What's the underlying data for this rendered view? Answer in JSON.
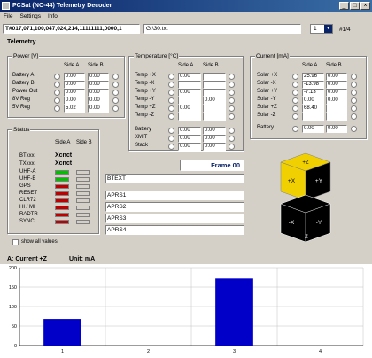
{
  "window": {
    "title": "PCSat (NO-44) Telemetry Decoder",
    "min": "_",
    "max": "□",
    "close": "×"
  },
  "menu": [
    "File",
    "Settings",
    "Info"
  ],
  "toolbar": {
    "packet": "T#017,071,100,047,024,214,11111111,0000,1",
    "filepath": "G:\\30.txt",
    "frame_select": "1",
    "frame_index": "#1/4"
  },
  "telemetry_label": "Telemetry",
  "power": {
    "title": "Power [V]",
    "side_a": "Side A",
    "side_b": "Side B",
    "rows": [
      {
        "label": "Battery A",
        "a": "0.00",
        "b": "0.00"
      },
      {
        "label": "Battery B",
        "a": "0.00",
        "b": "0.00"
      },
      {
        "label": "Power Out",
        "a": "0.00",
        "b": "0.00"
      },
      {
        "label": "8V Reg",
        "a": "0.00",
        "b": "0.00"
      },
      {
        "label": "5V Reg",
        "a": "5.02",
        "b": "0.00"
      }
    ]
  },
  "temperature": {
    "title": "Temperature [°C]",
    "side_a": "Side A",
    "side_b": "Side B",
    "rows": [
      {
        "label": "Temp +X",
        "a": "0.00",
        "b": ""
      },
      {
        "label": "Temp -X",
        "a": "",
        "b": ""
      },
      {
        "label": "Temp +Y",
        "a": "0.00",
        "b": ""
      },
      {
        "label": "Temp -Y",
        "a": "",
        "b": "0.00"
      },
      {
        "label": "Temp +Z",
        "a": "0.00",
        "b": ""
      },
      {
        "label": "Temp -Z",
        "a": "",
        "b": ""
      }
    ],
    "extra": [
      {
        "label": "Battery",
        "a": "0.00",
        "b": "0.00"
      },
      {
        "label": "XMIT",
        "a": "0.00",
        "b": "0.00"
      },
      {
        "label": "Stack",
        "a": "0.00",
        "b": "0.00"
      }
    ]
  },
  "current": {
    "title": "Current [mA]",
    "side_a": "Side A",
    "side_b": "Side B",
    "rows": [
      {
        "label": "Solar +X",
        "a": "25.96",
        "b": "0.00"
      },
      {
        "label": "Solar -X",
        "a": "-13.98",
        "b": "0.00"
      },
      {
        "label": "Solar +Y",
        "a": "-7.13",
        "b": "0.00"
      },
      {
        "label": "Solar -Y",
        "a": "0.00",
        "b": "0.00"
      },
      {
        "label": "Solar +Z",
        "a": "68.40",
        "b": ""
      },
      {
        "label": "Solar -Z",
        "a": "",
        "b": ""
      }
    ],
    "battery": {
      "label": "Battery",
      "a": "0.00",
      "b": "0.00"
    }
  },
  "status": {
    "title": "Status",
    "side_a": "Side A",
    "side_b": "Side B",
    "btxxx": {
      "label": "BTxxx",
      "value": "Xcnct"
    },
    "txxx": {
      "label": "TXxxx",
      "value": "Xcnct"
    },
    "rows": [
      {
        "label": "UHF-A",
        "a": "green",
        "b": "gray"
      },
      {
        "label": "UHF-B",
        "a": "green",
        "b": "gray"
      },
      {
        "label": "GPS",
        "a": "red",
        "b": "gray"
      },
      {
        "label": "RESET",
        "a": "red",
        "b": "gray"
      },
      {
        "label": "CLR72",
        "a": "red",
        "b": "gray"
      },
      {
        "label": "HI / MI",
        "a": "red",
        "b": "gray"
      },
      {
        "label": "RADTR",
        "a": "red",
        "b": "gray"
      },
      {
        "label": "SYNC",
        "a": "red",
        "b": "gray"
      }
    ],
    "show_all": "show all values"
  },
  "frame_label": "Frame 00",
  "text_fields": [
    "BTEXT",
    "APRS1",
    "APRS2",
    "APRS3",
    "APRS4"
  ],
  "cube": {
    "top": "+Z",
    "left": "+X",
    "right": "+Y",
    "bottom_left": "-X",
    "bottom_right": "-Y",
    "bottom": "-Z"
  },
  "colors": {
    "led_green": "#00c000",
    "led_red": "#c00000",
    "led_gray": "#d4d0c8",
    "bar": "#0000c8",
    "cube_yellow": "#f0d000"
  },
  "chart_data": {
    "type": "bar",
    "title": "A: Current +Z",
    "unit": "Unit: mA",
    "categories": [
      "1",
      "2",
      "3",
      "4"
    ],
    "values": [
      68,
      0,
      172,
      0
    ],
    "ylim": [
      0,
      200
    ],
    "yticks": [
      "0",
      "50",
      "100",
      "150",
      "200"
    ],
    "grid": true
  }
}
